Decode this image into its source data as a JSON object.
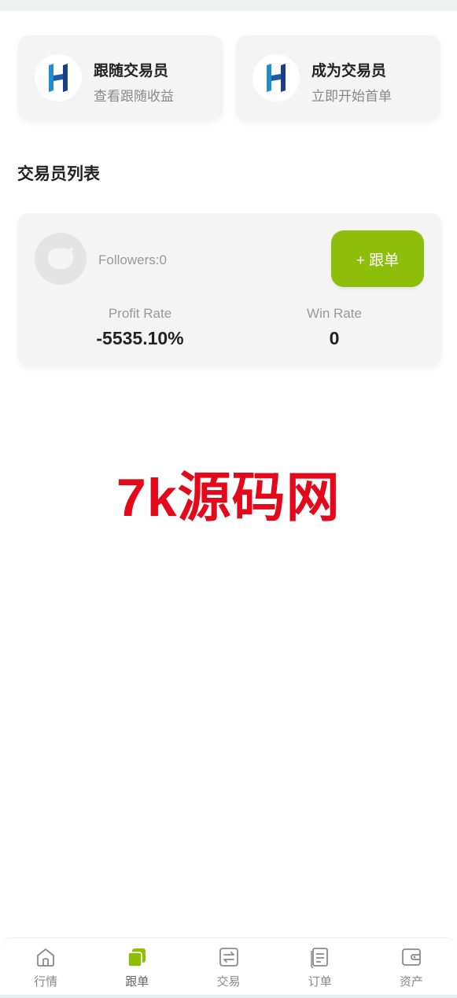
{
  "actions": [
    {
      "title": "跟随交易员",
      "subtitle": "查看跟随收益",
      "icon": "brand-logo-icon"
    },
    {
      "title": "成为交易员",
      "subtitle": "立即开始首单",
      "icon": "brand-logo-icon"
    }
  ],
  "section_title": "交易员列表",
  "trader": {
    "followers": "Followers:0",
    "follow_button": "+ 跟单",
    "profit_rate_label": "Profit Rate",
    "profit_rate_value": "-5535.10%",
    "win_rate_label": "Win Rate",
    "win_rate_value": "0"
  },
  "watermark": "7k源码网",
  "tabbar": {
    "items": [
      {
        "label": "行情",
        "icon": "home-icon"
      },
      {
        "label": "跟单",
        "icon": "copy-trade-icon",
        "active": true
      },
      {
        "label": "交易",
        "icon": "exchange-icon"
      },
      {
        "label": "订单",
        "icon": "orders-icon"
      },
      {
        "label": "资产",
        "icon": "wallet-icon"
      }
    ]
  },
  "colors": {
    "accent": "#8dbe0a",
    "watermark": "#e3081a",
    "logo_blue": "#1e5aa8"
  }
}
